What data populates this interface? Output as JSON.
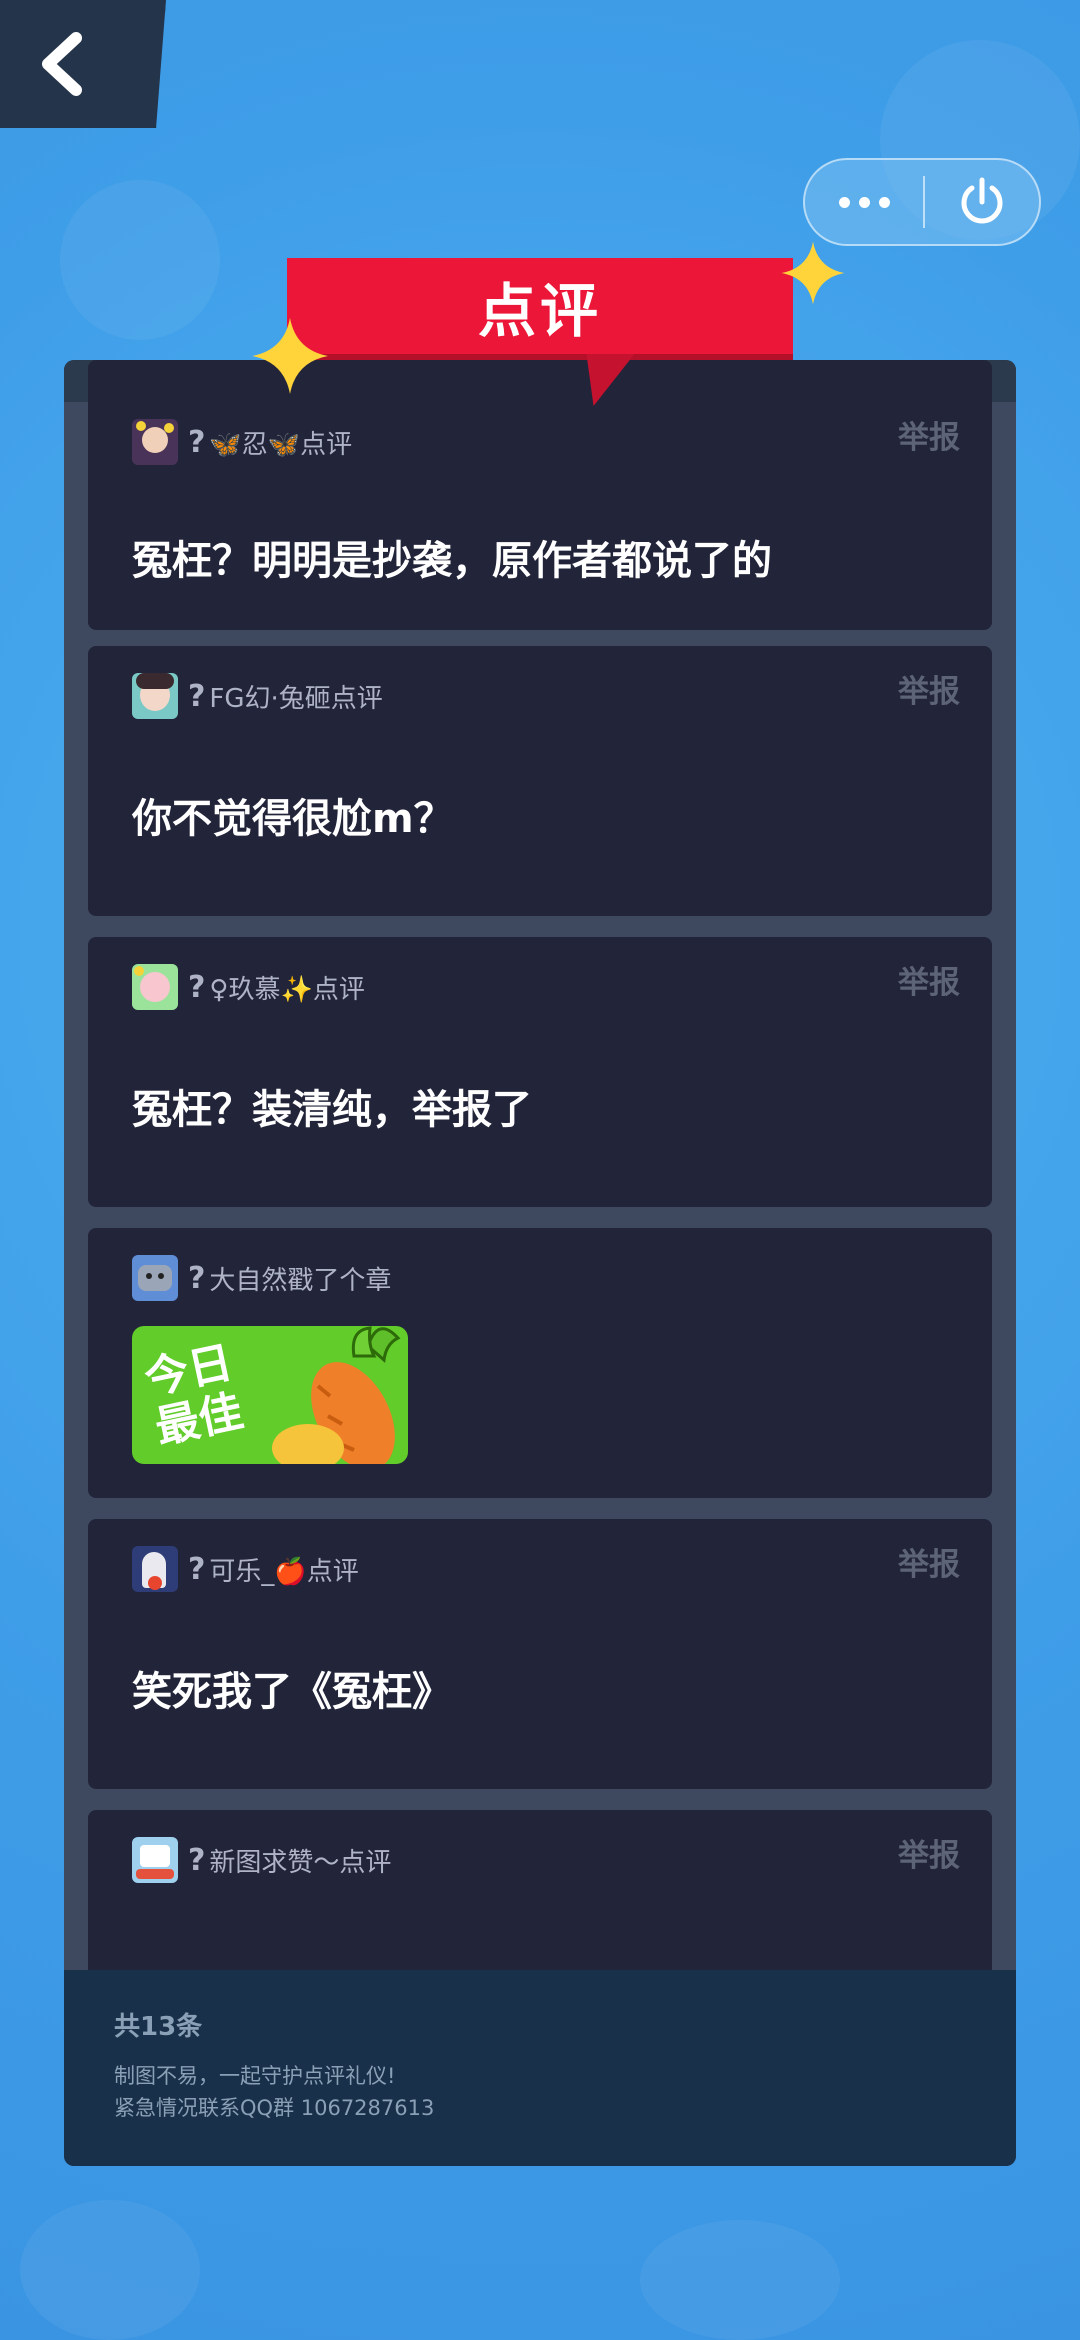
{
  "header": {
    "title": "点评"
  },
  "nav": {
    "back_icon": "chevron-left-icon",
    "more_icon": "more-dots-icon",
    "close_icon": "power-icon"
  },
  "comments": [
    {
      "prefix": "?",
      "nickname": "🦋忍🦋点评",
      "text": "冤枉？明明是抄袭，原作者都说了的",
      "report": "举报",
      "avatar_color": "#4a3358"
    },
    {
      "prefix": "?",
      "nickname": "FG幻·兔砸点评",
      "text": "你不觉得很尬m？",
      "report": "举报",
      "avatar_color": "#7ac9c7"
    },
    {
      "prefix": "?",
      "nickname": "♀玖慕✨点评",
      "text": "冤枉？装清纯，举报了",
      "report": "举报",
      "avatar_color": "#9be39a"
    },
    {
      "prefix": "?",
      "nickname": "大自然戳了个章",
      "text": "",
      "report": "",
      "avatar_color": "#5f8dd6",
      "sticker": "今日\n最佳"
    },
    {
      "prefix": "?",
      "nickname": "可乐_🍎点评",
      "text": "笑死我了《冤枉》",
      "report": "举报",
      "avatar_color": "#2e3d78"
    },
    {
      "prefix": "?",
      "nickname": "新图求赞～点评",
      "text": "",
      "report": "举报",
      "avatar_color": "#9fd0ee"
    }
  ],
  "footer": {
    "count": "共13条",
    "line1": "制图不易，一起守护点评礼仪!",
    "line2": "紧急情况联系QQ群 1067287613"
  },
  "colors": {
    "background": "#46a7ee",
    "banner": "#ec1738",
    "card": "#22243a",
    "panel": "#3e4960"
  }
}
